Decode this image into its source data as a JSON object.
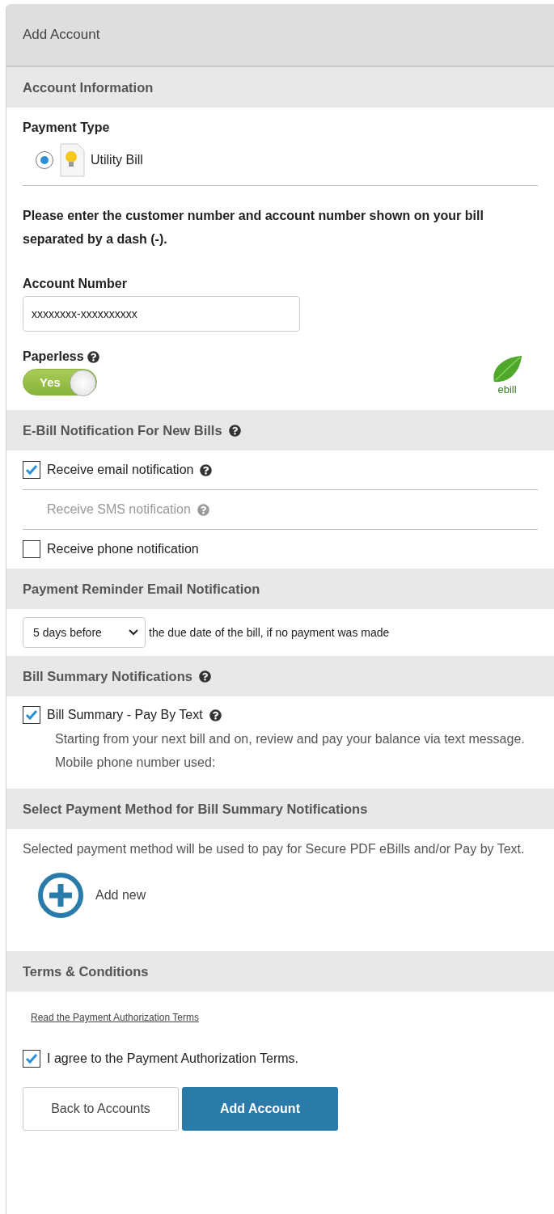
{
  "title": "Add Account",
  "account_information": {
    "heading": "Account Information",
    "payment_type": {
      "label": "Payment Type",
      "options": [
        {
          "label": "Utility Bill",
          "selected": true
        }
      ]
    },
    "instructions": "Please enter the customer number and account number shown on your bill separated by a dash (-).",
    "account_number": {
      "label": "Account Number",
      "value": "xxxxxxxx-xxxxxxxxxx"
    },
    "paperless": {
      "label": "Paperless",
      "on": true,
      "toggle_text": "Yes",
      "badge": "ebill"
    }
  },
  "ebill_notifications": {
    "heading": "E-Bill Notification For New Bills",
    "options": [
      {
        "label": "Receive email notification",
        "checked": true,
        "disabled": false,
        "help": true
      },
      {
        "label": "Receive SMS notification",
        "disabled": true,
        "help": true
      },
      {
        "label": "Receive phone notification",
        "checked": false,
        "disabled": false,
        "help": false
      }
    ]
  },
  "payment_reminder": {
    "heading": "Payment Reminder Email Notification",
    "select": {
      "value": "5 days before"
    },
    "suffix": "the due date of the bill, if no payment was made"
  },
  "bill_summary": {
    "heading": "Bill Summary Notifications",
    "option": {
      "label": "Bill Summary - Pay By Text",
      "checked": true
    },
    "description": "Starting from your next bill and on, review and pay your balance via text message.",
    "phone_label": "Mobile phone number used:"
  },
  "payment_method": {
    "heading": "Select Payment Method for Bill Summary Notifications",
    "description": "Selected payment method will be used to pay for Secure PDF eBills and/or Pay by Text.",
    "add_button": "Add new"
  },
  "terms": {
    "heading": "Terms & Conditions",
    "link": "Read the Payment Authorization Terms",
    "agree": {
      "label": "I agree to the Payment Authorization Terms.",
      "checked": true
    }
  },
  "buttons": [
    {
      "label": "Back to Accounts",
      "kind": "secondary"
    },
    {
      "label": "Add Account",
      "kind": "primary"
    }
  ]
}
